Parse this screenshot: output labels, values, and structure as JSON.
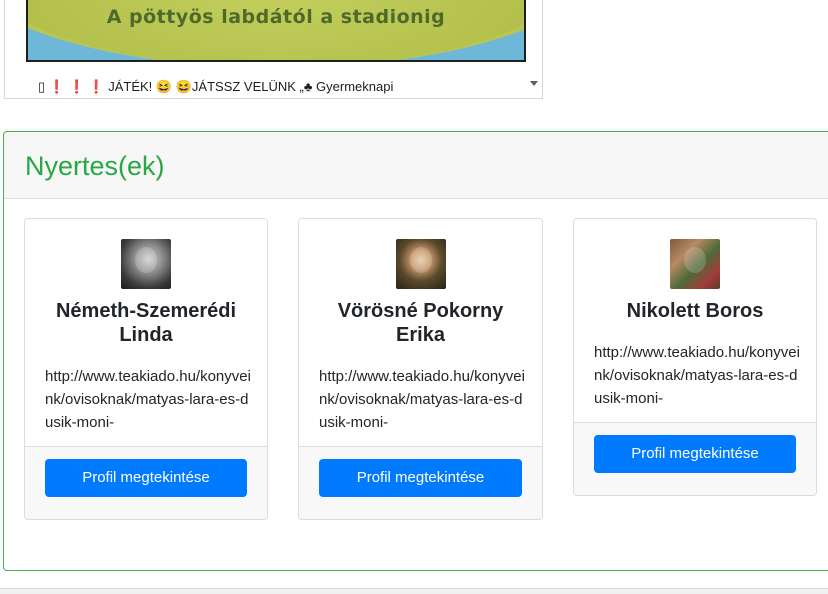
{
  "post": {
    "image_caption": "A pöttyös labdától a stadionig",
    "text_prefix": "▯",
    "text_marks": "❗ ❗ ❗",
    "text_game": "JÁTÉK!",
    "text_smile": "😆 😆",
    "text_play": "JÁTSSZ VELÜNK „",
    "text_club": "♣",
    "text_end": " Gyermeknapi"
  },
  "winners": {
    "title": "Nyertes(ek)",
    "cards": [
      {
        "name": "Németh-Szemerédi Linda",
        "link": "http://www.teakiado.hu/konyveink/ovisoknak/matyas-lara-es-dusik-moni-",
        "button": "Profil megtekintése"
      },
      {
        "name": "Vörösné Pokorny Erika",
        "link": "http://www.teakiado.hu/konyveink/ovisoknak/matyas-lara-es-dusik-moni-",
        "button": "Profil megtekintése"
      },
      {
        "name": "Nikolett Boros",
        "link": "http://www.teakiado.hu/konyveink/ovisoknak/matyas-lara-es-dusik-moni-",
        "button": "Profil megtekintése"
      }
    ]
  },
  "colors": {
    "accent_green": "#28a745",
    "button_blue": "#007bff"
  }
}
